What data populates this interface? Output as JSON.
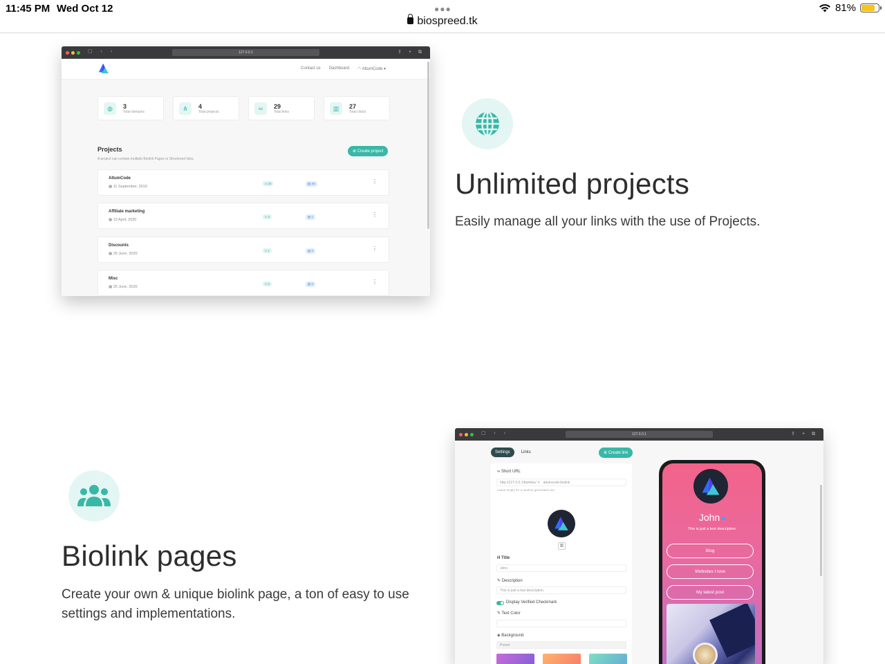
{
  "statusbar": {
    "time": "11:45 PM",
    "date": "Wed Oct 12",
    "url": "biospreed.tk",
    "battery_text": "81%",
    "battery_level": 0.81
  },
  "browser1": {
    "address": "127.0.0.1",
    "nav": {
      "contact": "Contact us",
      "dashboard": "Dashboard",
      "user": "AltumCode"
    },
    "stats": [
      {
        "icon": "globe-icon",
        "value": "3",
        "label": "Total domains"
      },
      {
        "icon": "project-icon",
        "value": "4",
        "label": "Total projects"
      },
      {
        "icon": "link-icon",
        "value": "29",
        "label": "Total links"
      },
      {
        "icon": "chart-icon",
        "value": "27",
        "label": "Total clicks"
      }
    ],
    "projects_title": "Projects",
    "projects_subtitle": "A project can contain multiple Biolink Pages or Shortened links.",
    "create_project": "Create project",
    "projects": [
      {
        "name": "AltumCode",
        "date": "11 September, 2019",
        "links": "25",
        "clicks": "26"
      },
      {
        "name": "Affiliate marketing",
        "date": "10 April, 2020",
        "links": "3",
        "clicks": "1"
      },
      {
        "name": "Discounts",
        "date": "25 June, 2020",
        "links": "1",
        "clicks": "0"
      },
      {
        "name": "Misc",
        "date": "25 June, 2020",
        "links": "0",
        "clicks": "0"
      }
    ]
  },
  "feature1": {
    "icon": "globe-icon",
    "title": "Unlimited projects",
    "description": "Easily manage all your links with the use of Projects."
  },
  "feature2": {
    "icon": "users-icon",
    "title": "Biolink pages",
    "description": "Create your own & unique biolink page, a ton of easy to use settings and implementations."
  },
  "browser2": {
    "address": "127.0.0.1",
    "tabs": [
      "Settings",
      "Links"
    ],
    "create_link": "Create link",
    "form": {
      "short_url_label": "Short URL",
      "short_url_prefix": "http://127.0.0.1/biolinks/",
      "short_url_value": "altumcode-biolink",
      "short_url_help": "Leave empty for a random generated one.",
      "title_label": "Title",
      "title_value": "John",
      "description_label": "Description",
      "description_value": "This is just a test description.",
      "verified_label": "Display Verified Checkmark",
      "text_color_label": "Text Color",
      "background_label": "Background",
      "background_value": "Preset"
    },
    "phone": {
      "name": "John",
      "description": "This is just a test description.",
      "buttons": [
        "Blog",
        "Websites I love",
        "My latest post"
      ]
    }
  },
  "colors": {
    "accent": "#39b7a7",
    "accent_light": "#e3f6f3"
  }
}
